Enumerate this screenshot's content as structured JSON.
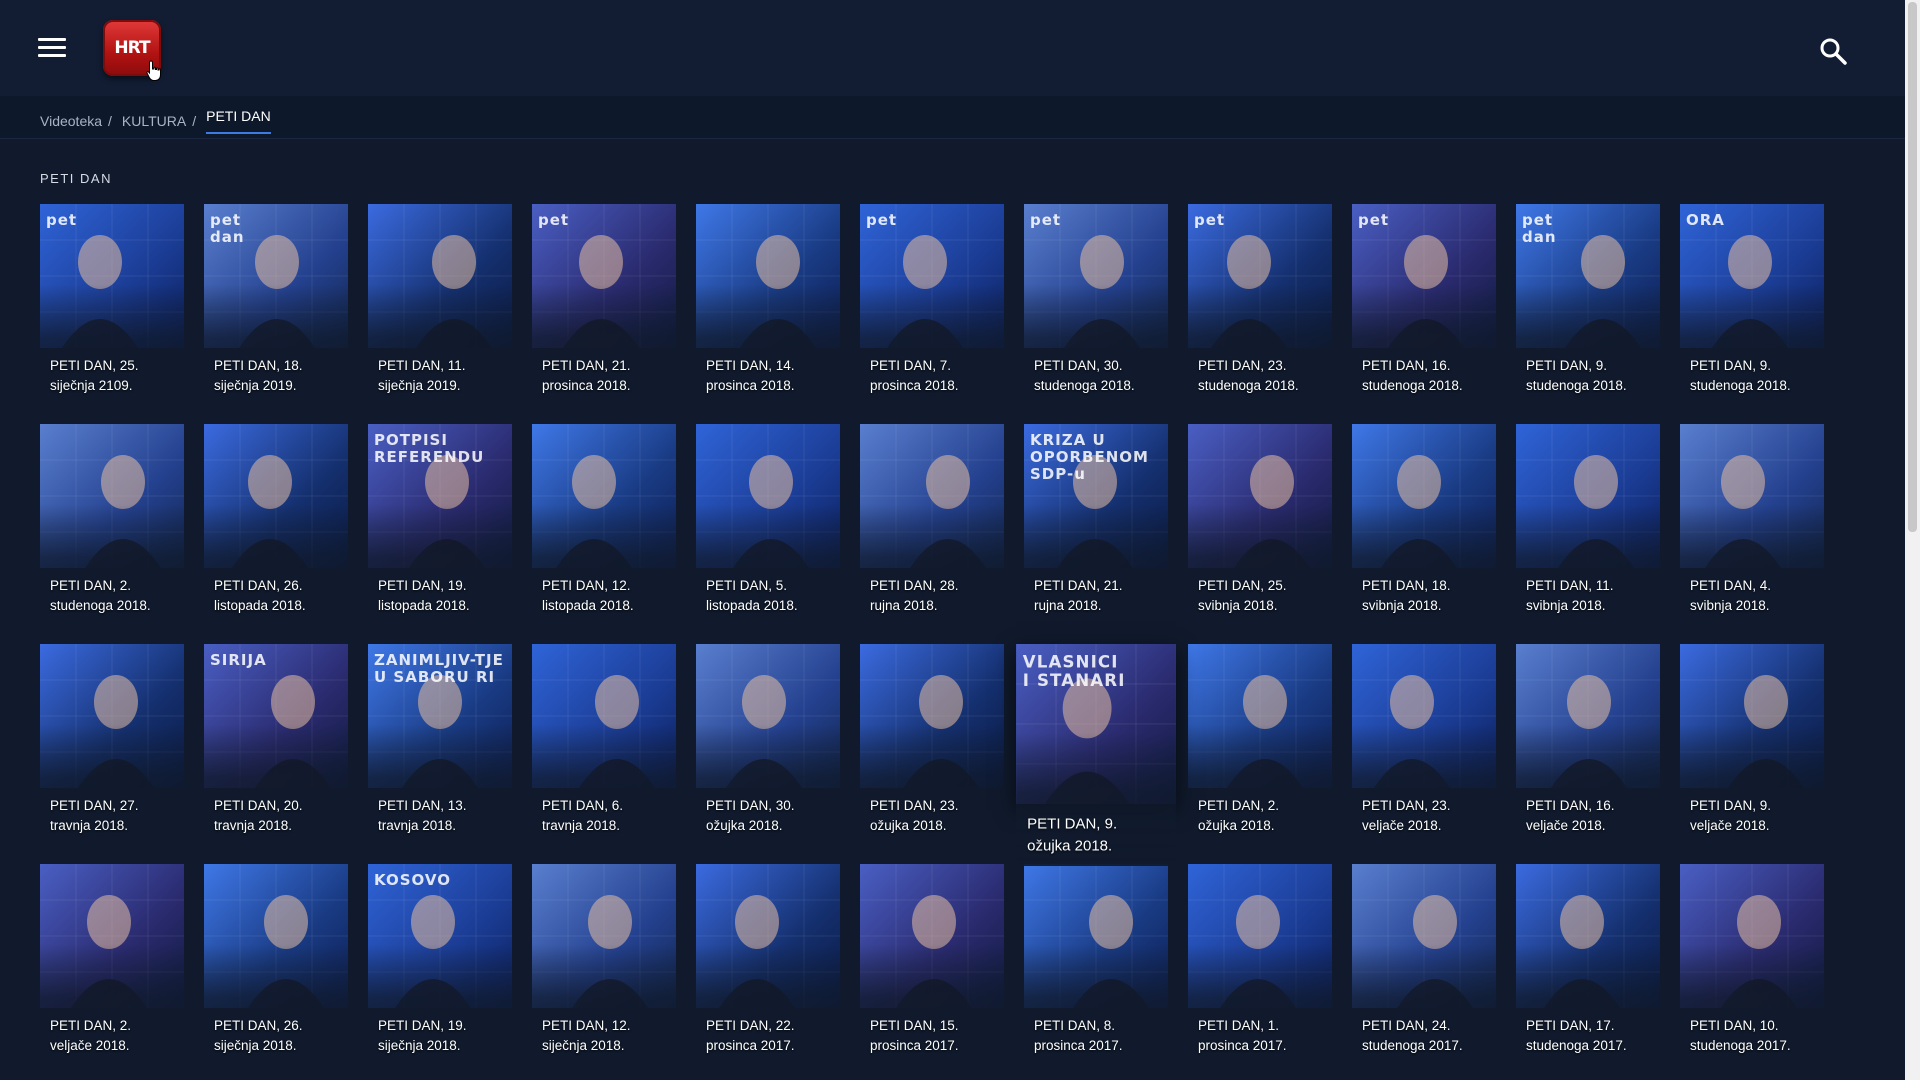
{
  "header": {
    "menu_icon": "hamburger-menu-icon",
    "logo_text": "HRT",
    "search_icon": "search-icon"
  },
  "breadcrumb": {
    "items": [
      "Videoteka",
      "KULTURA"
    ],
    "separator": "/",
    "current": "PETI DAN"
  },
  "section": {
    "title": "PETI DAN"
  },
  "colors": {
    "background": "#101a2c",
    "header": "#121d33",
    "accent": "#3c7be0",
    "logo": "#c01a1a"
  },
  "episodes": [
    {
      "line1": "PETI DAN, 25.",
      "line2": "siječnja 2109."
    },
    {
      "line1": "PETI DAN, 18.",
      "line2": "siječnja 2019."
    },
    {
      "line1": "PETI DAN, 11.",
      "line2": "siječnja 2019."
    },
    {
      "line1": "PETI DAN, 21.",
      "line2": "prosinca 2018."
    },
    {
      "line1": "PETI DAN, 14.",
      "line2": "prosinca 2018."
    },
    {
      "line1": "PETI DAN, 7.",
      "line2": "prosinca 2018."
    },
    {
      "line1": "PETI DAN, 30.",
      "line2": "studenoga 2018."
    },
    {
      "line1": "PETI DAN, 23.",
      "line2": "studenoga 2018."
    },
    {
      "line1": "PETI DAN, 16.",
      "line2": "studenoga 2018."
    },
    {
      "line1": "PETI DAN, 9.",
      "line2": "studenoga 2018."
    },
    {
      "line1": "PETI DAN, 9.",
      "line2": "studenoga 2018."
    },
    {
      "line1": "PETI DAN, 2.",
      "line2": "studenoga 2018."
    },
    {
      "line1": "PETI DAN, 26.",
      "line2": "listopada 2018."
    },
    {
      "line1": "PETI DAN, 19.",
      "line2": "listopada 2018."
    },
    {
      "line1": "PETI DAN, 12.",
      "line2": "listopada 2018."
    },
    {
      "line1": "PETI DAN, 5.",
      "line2": "listopada 2018."
    },
    {
      "line1": "PETI DAN, 28.",
      "line2": "rujna 2018."
    },
    {
      "line1": "PETI DAN, 21.",
      "line2": "rujna 2018."
    },
    {
      "line1": "PETI DAN, 25.",
      "line2": "svibnja 2018."
    },
    {
      "line1": "PETI DAN, 18.",
      "line2": "svibnja 2018."
    },
    {
      "line1": "PETI DAN, 11.",
      "line2": "svibnja 2018."
    },
    {
      "line1": "PETI DAN, 4.",
      "line2": "svibnja 2018."
    },
    {
      "line1": "PETI DAN, 27.",
      "line2": "travnja 2018."
    },
    {
      "line1": "PETI DAN, 20.",
      "line2": "travnja 2018."
    },
    {
      "line1": "PETI DAN, 13.",
      "line2": "travnja 2018."
    },
    {
      "line1": "PETI DAN, 6.",
      "line2": "travnja 2018."
    },
    {
      "line1": "PETI DAN, 30.",
      "line2": "ožujka 2018."
    },
    {
      "line1": "PETI DAN, 23.",
      "line2": "ožujka 2018."
    },
    {
      "line1": "PETI DAN, 9.",
      "line2": "ožujka 2018."
    },
    {
      "line1": "PETI DAN, 2.",
      "line2": "ožujka 2018."
    },
    {
      "line1": "PETI DAN, 23.",
      "line2": "veljače 2018."
    },
    {
      "line1": "PETI DAN, 16.",
      "line2": "veljače 2018."
    },
    {
      "line1": "PETI DAN, 9.",
      "line2": "veljače 2018."
    },
    {
      "line1": "PETI DAN, 2.",
      "line2": "veljače 2018."
    },
    {
      "line1": "PETI DAN, 26.",
      "line2": "siječnja 2018."
    },
    {
      "line1": "PETI DAN, 19.",
      "line2": "siječnja 2018."
    },
    {
      "line1": "PETI DAN, 12.",
      "line2": "siječnja 2018."
    },
    {
      "line1": "PETI DAN, 22.",
      "line2": "prosinca 2017."
    },
    {
      "line1": "PETI DAN, 15.",
      "line2": "prosinca 2017."
    },
    {
      "line1": "PETI DAN, 8.",
      "line2": "prosinca 2017."
    },
    {
      "line1": "PETI DAN, 1.",
      "line2": "prosinca 2017."
    },
    {
      "line1": "PETI DAN, 24.",
      "line2": "studenoga 2017."
    },
    {
      "line1": "PETI DAN, 17.",
      "line2": "studenoga 2017."
    },
    {
      "line1": "PETI DAN, 10.",
      "line2": "studenoga 2017."
    }
  ],
  "thumb_overlays": {
    "0": [
      "pet"
    ],
    "1": [
      "pet",
      "dan"
    ],
    "3": [
      "pet"
    ],
    "5": [
      "pet"
    ],
    "6": [
      "pet"
    ],
    "7": [
      "pet"
    ],
    "8": [
      "pet"
    ],
    "9": [
      "pet",
      "dan"
    ],
    "10": [
      "ORA"
    ],
    "13": [
      "POTPISI",
      "REFERENDU"
    ],
    "17": [
      "KRIZA U",
      "OPORBENOM",
      "SDP-u"
    ],
    "23": [
      "SIRIJA"
    ],
    "24": [
      "ZANIMLJIV-TJE",
      "U SABORU RI"
    ],
    "28": [
      "VLASNICI",
      "I STANARI"
    ],
    "35": [
      "KOSOVO"
    ]
  },
  "hovered_index": 28
}
